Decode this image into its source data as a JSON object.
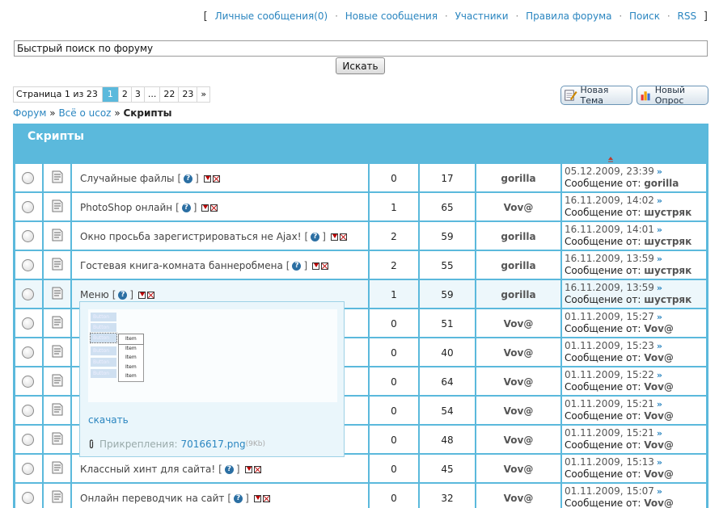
{
  "topnav": {
    "open": "[",
    "close": "]",
    "links": [
      "Личные сообщения(0)",
      "Новые сообщения",
      "Участники",
      "Правила форума",
      "Поиск",
      "RSS"
    ]
  },
  "search": {
    "value": "Быстрый поиск по форуму",
    "button": "Искать"
  },
  "pager": {
    "label": "Страница 1 из 23",
    "pages": [
      "1",
      "2",
      "3",
      "...",
      "22",
      "23",
      "»"
    ]
  },
  "actions": {
    "new_topic": "Новая Тема",
    "new_poll": "Новый Опрос"
  },
  "breadcrumb": {
    "forum": "Форум",
    "sep": "»",
    "section": "Всё о ucoz",
    "current": "Скрипты"
  },
  "table": {
    "title": "Скрипты"
  },
  "topics": [
    {
      "title": "Случайные файлы",
      "replies": "0",
      "views": "17",
      "author": "gorilla",
      "last_date": "05.12.2009, 23:39",
      "last_by": "gorilla"
    },
    {
      "title": "PhotoShop онлайн",
      "replies": "1",
      "views": "65",
      "author": "Vov@",
      "last_date": "16.11.2009, 14:02",
      "last_by": "шустряк"
    },
    {
      "title": "Окно просьба зарегистрироваться не Ajax!",
      "replies": "2",
      "views": "59",
      "author": "gorilla",
      "last_date": "16.11.2009, 14:01",
      "last_by": "шустряк"
    },
    {
      "title": "Гостевая книга-комната баннеробмена",
      "replies": "2",
      "views": "55",
      "author": "gorilla",
      "last_date": "16.11.2009, 13:59",
      "last_by": "шустряк"
    },
    {
      "title": "Меню",
      "replies": "1",
      "views": "59",
      "author": "gorilla",
      "last_date": "16.11.2009, 13:59",
      "last_by": "шустряк"
    },
    {
      "title": "",
      "replies": "0",
      "views": "51",
      "author": "Vov@",
      "last_date": "01.11.2009, 15:27",
      "last_by": "Vov@"
    },
    {
      "title": "",
      "replies": "0",
      "views": "40",
      "author": "Vov@",
      "last_date": "01.11.2009, 15:23",
      "last_by": "Vov@"
    },
    {
      "title": "",
      "replies": "0",
      "views": "64",
      "author": "Vov@",
      "last_date": "01.11.2009, 15:22",
      "last_by": "Vov@"
    },
    {
      "title": "",
      "replies": "0",
      "views": "54",
      "author": "Vov@",
      "last_date": "01.11.2009, 15:21",
      "last_by": "Vov@"
    },
    {
      "title": "",
      "replies": "0",
      "views": "48",
      "author": "Vov@",
      "last_date": "01.11.2009, 15:21",
      "last_by": "Vov@"
    },
    {
      "title": "Классный хинт для сайта!",
      "replies": "0",
      "views": "45",
      "author": "Vov@",
      "last_date": "01.11.2009, 15:13",
      "last_by": "Vov@"
    },
    {
      "title": "Онлайн переводчик на сайт",
      "replies": "0",
      "views": "32",
      "author": "Vov@",
      "last_date": "01.11.2009, 15:07",
      "last_by": "Vov@"
    }
  ],
  "last_by_label": "Сообщение от:",
  "popup": {
    "download": "скачать",
    "attach_label": "Прикрепления:",
    "file": "7016617.png",
    "size": "(9Kb)",
    "menu_buttons": [
      "Button",
      "Button",
      "Button",
      "Button",
      "Button",
      "Button"
    ],
    "submenu_items": [
      "Item",
      "Item",
      "Item",
      "Item",
      "Item"
    ]
  },
  "colors": {
    "accent": "#5bb9dc",
    "link": "#2b86c0"
  }
}
